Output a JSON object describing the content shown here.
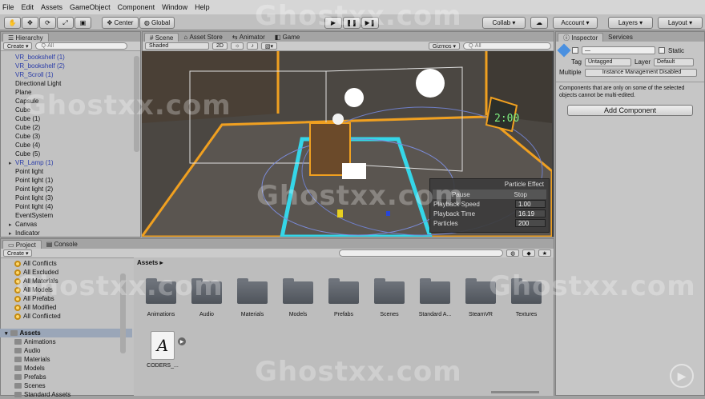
{
  "menu": [
    "File",
    "Edit",
    "Assets",
    "GameObject",
    "Component",
    "Window",
    "Help"
  ],
  "toolbar": {
    "pivot": "Center",
    "space": "Global",
    "collab": "Collab ▾",
    "account": "Account",
    "layers": "Layers",
    "layout": "Layout"
  },
  "hierarchy": {
    "tab": "Hierarchy",
    "create": "Create ▾",
    "search": "Q·All",
    "items": [
      {
        "label": "VR_bookshelf (1)",
        "prefab": true,
        "arrow": false
      },
      {
        "label": "VR_bookshelf (2)",
        "prefab": true,
        "arrow": false
      },
      {
        "label": "VR_Scroll (1)",
        "prefab": true,
        "arrow": false
      },
      {
        "label": "Directional Light",
        "prefab": false,
        "arrow": false
      },
      {
        "label": "Plane",
        "prefab": false,
        "arrow": false
      },
      {
        "label": "Capsule",
        "prefab": false,
        "arrow": false
      },
      {
        "label": "Cube",
        "prefab": false,
        "arrow": false
      },
      {
        "label": "Cube (1)",
        "prefab": false,
        "arrow": false
      },
      {
        "label": "Cube (2)",
        "prefab": false,
        "arrow": false
      },
      {
        "label": "Cube (3)",
        "prefab": false,
        "arrow": false
      },
      {
        "label": "Cube (4)",
        "prefab": false,
        "arrow": false
      },
      {
        "label": "Cube (5)",
        "prefab": false,
        "arrow": false
      },
      {
        "label": "VR_Lamp (1)",
        "prefab": true,
        "arrow": true
      },
      {
        "label": "Point light",
        "prefab": false,
        "arrow": false
      },
      {
        "label": "Point light (1)",
        "prefab": false,
        "arrow": false
      },
      {
        "label": "Point light (2)",
        "prefab": false,
        "arrow": false
      },
      {
        "label": "Point light (3)",
        "prefab": false,
        "arrow": false
      },
      {
        "label": "Point light (4)",
        "prefab": false,
        "arrow": false
      },
      {
        "label": "EventSystem",
        "prefab": false,
        "arrow": false
      },
      {
        "label": "Canvas",
        "prefab": false,
        "arrow": true
      },
      {
        "label": "Indicator",
        "prefab": false,
        "arrow": true
      }
    ]
  },
  "scene": {
    "tabs": [
      "Scene",
      "Asset Store",
      "Animator",
      "Game"
    ],
    "shading": "Shaded",
    "mode2d": "2D",
    "gizmos": "Gizmos ▾",
    "search": "Q·All",
    "clock": "2:00",
    "particle": {
      "title": "Particle Effect",
      "pause": "Pause",
      "stop": "Stop",
      "rows": [
        {
          "label": "Playback Speed",
          "value": "1.00"
        },
        {
          "label": "Playback Time",
          "value": "16.19"
        },
        {
          "label": "Particles",
          "value": "200"
        }
      ]
    }
  },
  "inspector": {
    "tabs": [
      "Inspector",
      "Services"
    ],
    "static": "Static",
    "tag_label": "Tag",
    "tag": "Untagged",
    "layer_label": "Layer",
    "layer": "Default",
    "multiple": "Multiple",
    "instance": "Instance Management Disabled",
    "note": "Components that are only on some of the selected objects cannot be multi-edited.",
    "add_component": "Add Component"
  },
  "project": {
    "tabs": [
      "Project",
      "Console"
    ],
    "create": "Create ▾",
    "favorites": [
      "All Conflicts",
      "All Excluded",
      "All Materials",
      "All Models",
      "All Prefabs",
      "All Modified",
      "All Conflicted"
    ],
    "assets_root": "Assets",
    "tree": [
      "Animations",
      "Audio",
      "Materials",
      "Models",
      "Prefabs",
      "Scenes",
      "Standard Assets"
    ],
    "breadcrumb": "Assets ▸",
    "folders": [
      "Animations",
      "Audio",
      "Materials",
      "Models",
      "Prefabs",
      "Scenes",
      "Standard A...",
      "SteamVR",
      "Textures"
    ],
    "file": "CODERS_..."
  },
  "watermark": "Ghostxx.com",
  "colors": {
    "selection_orange": "#f0a020",
    "selection_cyan": "#35d6e8",
    "prefab_blue": "#2a3ca8"
  }
}
